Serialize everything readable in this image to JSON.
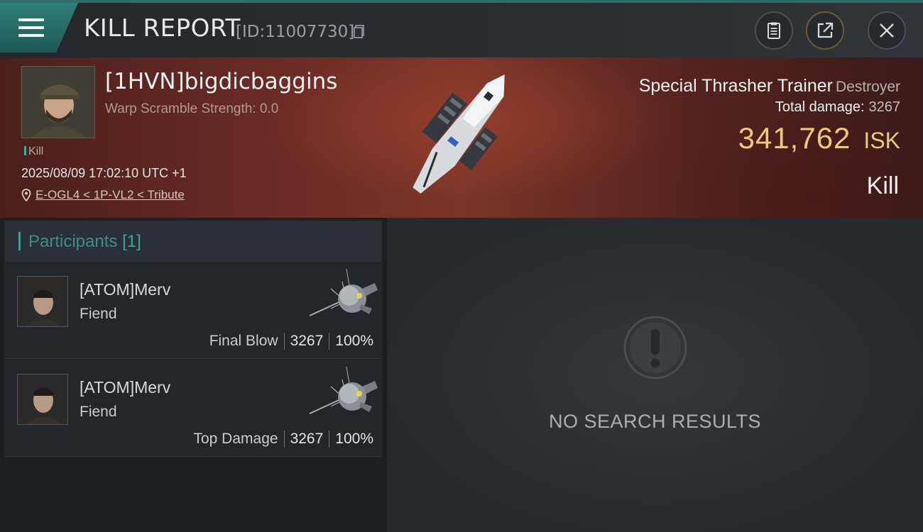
{
  "header": {
    "title": "KILL REPORT",
    "report_id": "[ID:11007730]"
  },
  "victim": {
    "name": "[1HVN]bigdicbaggins",
    "warp_scramble": "Warp Scramble Strength: 0.0",
    "tag": "Kill",
    "timestamp": "2025/08/09 17:02:10 UTC +1",
    "location": "E-OGL4 < 1P-VL2 < Tribute",
    "ship_name": "Special Thrasher Trainer",
    "ship_class": "Destroyer",
    "total_damage_label": "Total damage:",
    "total_damage": "3267",
    "isk_value": "341,762",
    "isk_unit": "ISK",
    "result": "Kill"
  },
  "participants": {
    "title": "Participants",
    "count": "[1]",
    "rows": [
      {
        "name": "[ATOM]Merv",
        "ship": "Fiend",
        "role": "Final Blow",
        "damage": "3267",
        "percent": "100%"
      },
      {
        "name": "[ATOM]Merv",
        "ship": "Fiend",
        "role": "Top Damage",
        "damage": "3267",
        "percent": "100%"
      }
    ]
  },
  "right_panel": {
    "empty_message": "NO SEARCH RESULTS"
  },
  "icons": {
    "menu": "hamburger-menu-icon",
    "copy": "copy-icon",
    "clipboard": "clipboard-icon",
    "share": "share-icon",
    "close": "close-icon",
    "location": "location-pin-icon",
    "empty": "exclamation-circle-icon"
  },
  "colors": {
    "accent": "#3f9f96",
    "isk": "#f0c87a",
    "banner": "#6b2b25"
  }
}
